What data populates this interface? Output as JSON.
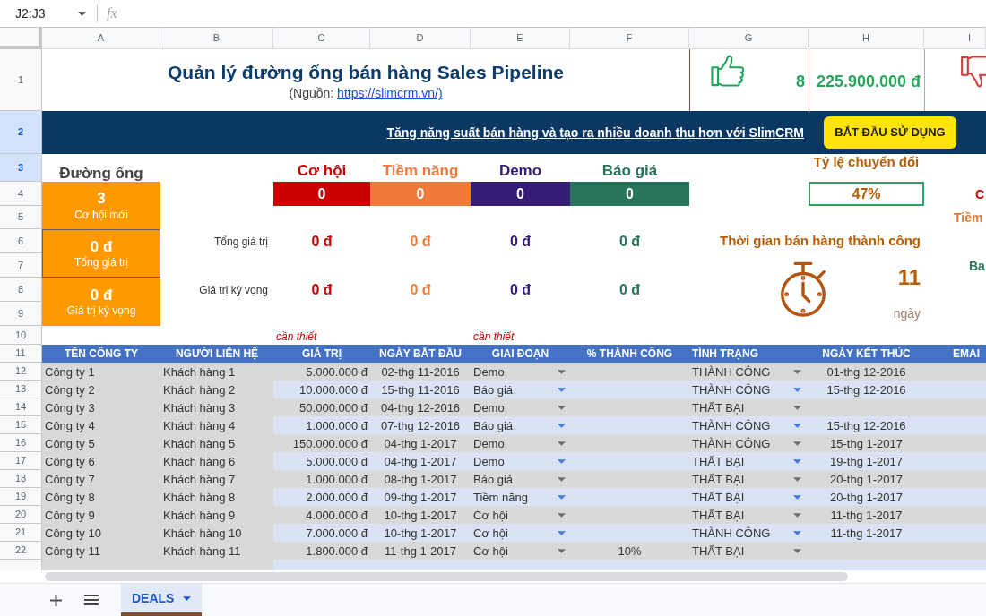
{
  "formula_bar": {
    "name_box": "J2:J3",
    "function_label": "fx"
  },
  "column_headers": [
    "A",
    "B",
    "C",
    "D",
    "E",
    "F",
    "G",
    "H",
    "I"
  ],
  "row_headers": [
    {
      "label": "1",
      "selected": false
    },
    {
      "label": "2",
      "selected": true
    },
    {
      "label": "3",
      "selected": true
    },
    {
      "label": "4",
      "selected": false
    },
    {
      "label": "5",
      "selected": false
    },
    {
      "label": "6",
      "selected": false
    },
    {
      "label": "7",
      "selected": false
    },
    {
      "label": "8",
      "selected": false
    },
    {
      "label": "9",
      "selected": false
    },
    {
      "label": "10",
      "selected": false
    },
    {
      "label": "11",
      "selected": false
    },
    {
      "label": "12",
      "selected": false
    },
    {
      "label": "13",
      "selected": false
    },
    {
      "label": "14",
      "selected": false
    },
    {
      "label": "15",
      "selected": false
    },
    {
      "label": "16",
      "selected": false
    },
    {
      "label": "17",
      "selected": false
    },
    {
      "label": "18",
      "selected": false
    },
    {
      "label": "19",
      "selected": false
    },
    {
      "label": "20",
      "selected": false
    },
    {
      "label": "21",
      "selected": false
    },
    {
      "label": "22",
      "selected": false
    }
  ],
  "title": "Quản lý đường ống bán hàng Sales Pipeline",
  "source": {
    "prefix": "(Nguồn:",
    "link": "https://slimcrm.vn/)"
  },
  "won": {
    "count": "8",
    "amount": "225.900.000 đ"
  },
  "banner": {
    "text": "Tăng năng suất bán hàng và tạo ra nhiều doanh thu hơn với SlimCRM",
    "button": "BẮT ĐẦU SỬ DỤNG"
  },
  "pipeline": {
    "title": "Đường ống",
    "cards": [
      {
        "value": "3",
        "label": "Cơ hội mới"
      },
      {
        "value": "0 đ",
        "label": "Tổng giá trị"
      },
      {
        "value": "0 đ",
        "label": "Giá trị kỳ vọng"
      }
    ]
  },
  "stages": [
    {
      "name": "Cơ hội",
      "color": "#cc0000",
      "count": "0",
      "total": "0 đ",
      "expected": "0 đ"
    },
    {
      "name": "Tiềm năng",
      "color": "#f1793a",
      "count": "0",
      "total": "0 đ",
      "expected": "0 đ"
    },
    {
      "name": "Demo",
      "color": "#351c75",
      "count": "0",
      "total": "0 đ",
      "expected": "0 đ"
    },
    {
      "name": "Báo giá",
      "color": "#26755a",
      "count": "0",
      "total": "0 đ",
      "expected": "0 đ"
    }
  ],
  "stage_row_labels": [
    "Tổng giá trị",
    "Giá trị kỳ vọng"
  ],
  "conversion_rate": {
    "title": "Tỷ lệ chuyển đổi",
    "value": "47%"
  },
  "sales_cycle": {
    "title": "Thời gian bán hàng thành công",
    "value": "11",
    "unit": "ngày"
  },
  "column_i_labels": [
    {
      "text": "C",
      "color": "#cc0000"
    },
    {
      "text": "Tiềm",
      "color": "#e6772e"
    },
    {
      "text": "Ba",
      "color": "#2e7556"
    }
  ],
  "required_notes": [
    "cần thiết",
    "cần thiết"
  ],
  "table": {
    "columns": [
      "TÊN CÔNG TY",
      "NGƯỜI LIÊN HỆ",
      "GIÁ TRỊ",
      "NGÀY BẮT ĐẦU",
      "GIAI ĐOẠN",
      "% THÀNH CÔNG",
      "TÌNH TRẠNG",
      "NGÀY KẾT THÚC",
      "EMAI"
    ],
    "rows": [
      {
        "company": "Công ty 1",
        "contact": "Khách hàng 1",
        "value": "5.000.000 đ",
        "start_date": "02-thg 11-2016",
        "stage": "Demo",
        "status": "THÀNH CÔNG",
        "end_date": "01-thg 12-2016"
      },
      {
        "company": "Công ty 2",
        "contact": "Khách hàng 2",
        "value": "10.000.000 đ",
        "start_date": "15-thg 11-2016",
        "stage": "Báo giá",
        "status": "THÀNH CÔNG",
        "end_date": "15-thg 12-2016"
      },
      {
        "company": "Công ty 3",
        "contact": "Khách hàng 3",
        "value": "50.000.000 đ",
        "start_date": "04-thg 12-2016",
        "stage": "Demo",
        "status": "THẤT BẠI"
      },
      {
        "company": "Công ty 4",
        "contact": "Khách hàng 4",
        "value": "1.000.000 đ",
        "start_date": "07-thg 12-2016",
        "stage": "Báo giá",
        "status": "THÀNH CÔNG",
        "end_date": "15-thg 12-2016"
      },
      {
        "company": "Công ty 5",
        "contact": "Khách hàng 5",
        "value": "150.000.000 đ",
        "start_date": "04-thg 1-2017",
        "stage": "Demo",
        "status": "THÀNH CÔNG",
        "end_date": "15-thg 1-2017"
      },
      {
        "company": "Công ty 6",
        "contact": "Khách hàng 6",
        "value": "5.000.000 đ",
        "start_date": "04-thg 1-2017",
        "stage": "Demo",
        "status": "THẤT BẠI",
        "end_date": "19-thg 1-2017"
      },
      {
        "company": "Công ty 7",
        "contact": "Khách hàng 7",
        "value": "1.000.000 đ",
        "start_date": "08-thg 1-2017",
        "stage": "Báo giá",
        "status": "THẤT BẠI",
        "end_date": "20-thg 1-2017"
      },
      {
        "company": "Công ty 8",
        "contact": "Khách hàng 8",
        "value": "2.000.000 đ",
        "start_date": "09-thg 1-2017",
        "stage": "Tiềm năng",
        "status": "THẤT BẠI",
        "end_date": "20-thg 1-2017"
      },
      {
        "company": "Công ty 9",
        "contact": "Khách hàng 9",
        "value": "4.000.000 đ",
        "start_date": "10-thg 1-2017",
        "stage": "Cơ hội",
        "status": "THẤT BẠI",
        "end_date": "11-thg 1-2017"
      },
      {
        "company": "Công ty 10",
        "contact": "Khách hàng 10",
        "value": "7.000.000 đ",
        "start_date": "10-thg 1-2017",
        "stage": "Cơ hội",
        "status": "THÀNH CÔNG",
        "end_date": "11-thg 1-2017"
      },
      {
        "company": "Công ty 11",
        "contact": "Khách hàng 11",
        "value": "1.800.000 đ",
        "start_date": "11-thg 1-2017",
        "stage": "Cơ hội",
        "success_rate": "10%",
        "status": "THẤT BẠI"
      }
    ]
  },
  "sheet_tabs": [
    {
      "label": "DEALS",
      "selected": true
    }
  ]
}
